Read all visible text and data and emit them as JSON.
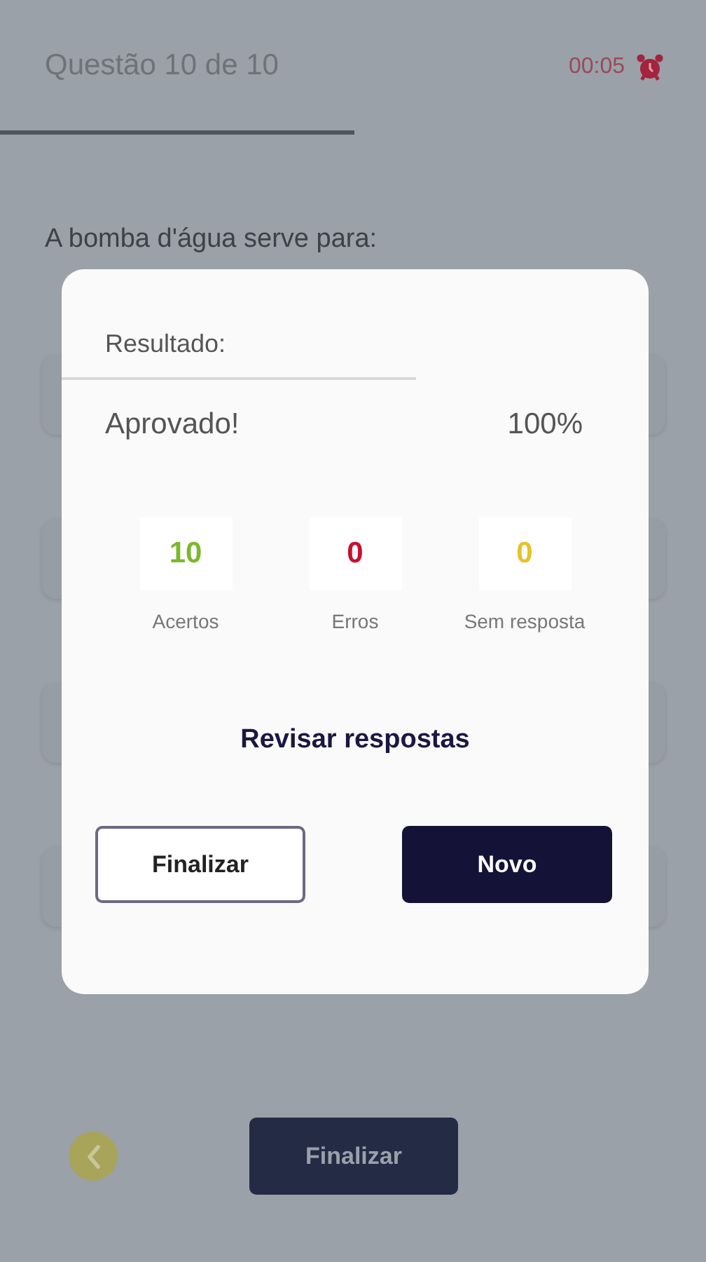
{
  "header": {
    "title": "Questão 10 de 10",
    "timer": "00:05"
  },
  "question": {
    "text": "A bomba d'água serve para:"
  },
  "footer": {
    "finish_button": "Finalizar"
  },
  "result_dialog": {
    "title": "Resultado:",
    "verdict": "Aprovado!",
    "score": "100%",
    "stats": [
      {
        "value": "10",
        "label": "Acertos",
        "color": "#7cb82f"
      },
      {
        "value": "0",
        "label": "Erros",
        "color": "#c8102e"
      },
      {
        "value": "0",
        "label": "Sem resposta",
        "color": "#e3c32a"
      }
    ],
    "review_link": "Revisar respostas",
    "buttons": [
      {
        "label": "Finalizar",
        "kind": "outline"
      },
      {
        "label": "Novo",
        "kind": "primary"
      }
    ]
  }
}
